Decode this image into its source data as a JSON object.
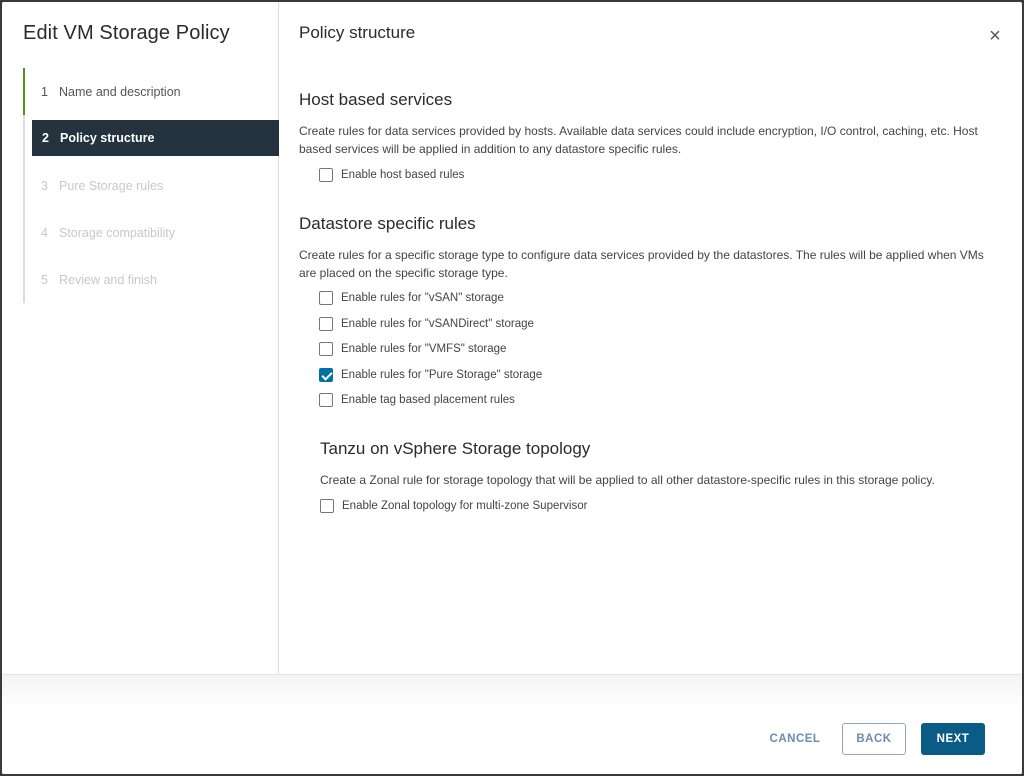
{
  "wizard": {
    "title": "Edit VM Storage Policy",
    "steps": [
      {
        "num": "1",
        "label": "Name and description"
      },
      {
        "num": "2",
        "label": "Policy structure"
      },
      {
        "num": "3",
        "label": "Pure Storage rules"
      },
      {
        "num": "4",
        "label": "Storage compatibility"
      },
      {
        "num": "5",
        "label": "Review and finish"
      }
    ]
  },
  "page": {
    "title": "Policy structure",
    "close_glyph": "×"
  },
  "host": {
    "title": "Host based services",
    "desc": "Create rules for data services provided by hosts. Available data services could include encryption, I/O control, caching, etc. Host based services will be applied in addition to any datastore specific rules.",
    "options": [
      {
        "label": "Enable host based rules",
        "checked": false
      }
    ]
  },
  "datastore": {
    "title": "Datastore specific rules",
    "desc": "Create rules for a specific storage type to configure data services provided by the datastores. The rules will be applied when VMs are placed on the specific storage type.",
    "options": [
      {
        "label": "Enable rules for \"vSAN\" storage",
        "checked": false
      },
      {
        "label": "Enable rules for \"vSANDirect\" storage",
        "checked": false
      },
      {
        "label": "Enable rules for \"VMFS\" storage",
        "checked": false
      },
      {
        "label": "Enable rules for \"Pure Storage\" storage",
        "checked": true
      },
      {
        "label": "Enable tag based placement rules",
        "checked": false
      }
    ]
  },
  "tanzu": {
    "title": "Tanzu on vSphere Storage topology",
    "desc": "Create a Zonal rule for storage topology that will be applied to all other datastore-specific rules in this storage policy.",
    "options": [
      {
        "label": "Enable Zonal topology for multi-zone Supervisor",
        "checked": false
      }
    ]
  },
  "footer": {
    "cancel": "CANCEL",
    "back": "BACK",
    "next": "NEXT"
  },
  "colors": {
    "accent": "#0072a3",
    "active_step_bg": "#25333e",
    "primary_button": "#0a5c87",
    "completed_step": "#5a8f1f"
  }
}
